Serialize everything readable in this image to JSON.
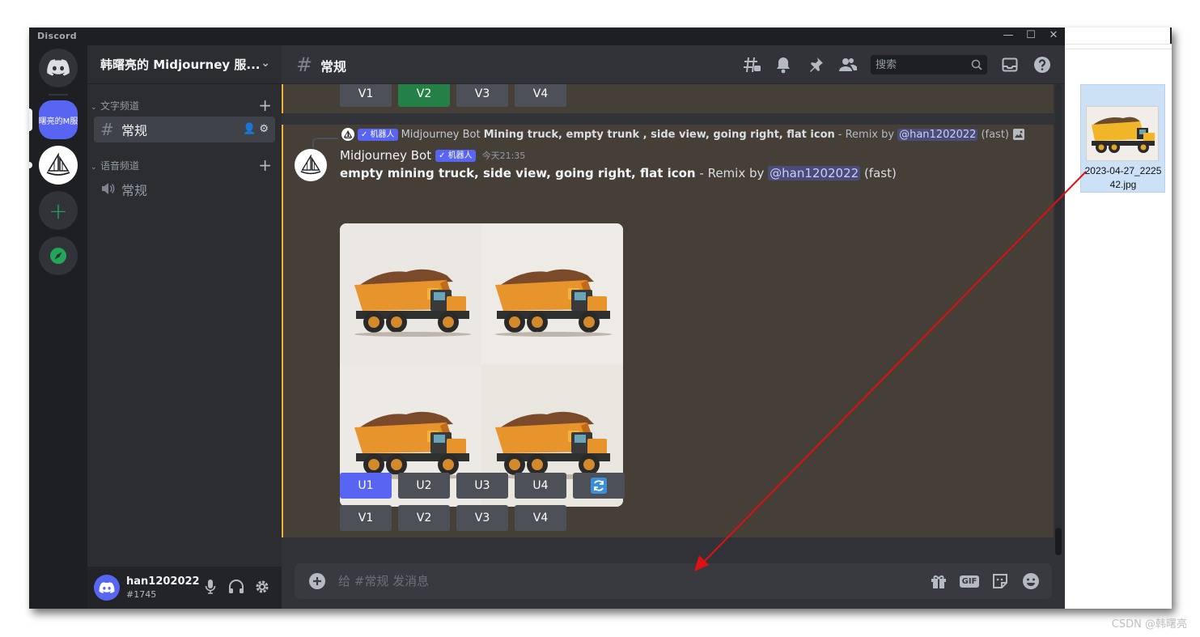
{
  "window": {
    "app_title": "Discord",
    "minimize": "—",
    "maximize": "☐",
    "close": "✕"
  },
  "server_rail": {
    "server1_label": "韩曙亮的M服务"
  },
  "sidebar": {
    "guild_name": "韩曙亮的 Midjourney 服...",
    "text_category": "文字频道",
    "voice_category": "语音频道",
    "text_channel": "常规",
    "voice_channel": "常规"
  },
  "user": {
    "name": "han1202022",
    "tag": "#1745"
  },
  "header": {
    "channel_title": "常规",
    "search_placeholder": "搜索"
  },
  "top_buttons": [
    "V1",
    "V2",
    "V3",
    "V4"
  ],
  "message": {
    "reply_badge": "✓ 机器人",
    "reply_author": "Midjourney Bot",
    "reply_prompt": "Mining truck, empty trunk , side view, going right, flat icon",
    "reply_suffix": "- Remix by",
    "reply_mention": "@han1202022",
    "reply_mode": "(fast)",
    "author": "Midjourney Bot",
    "badge": "✓ 机器人",
    "time": "今天21:35",
    "prompt": "empty mining truck, side view, going right, flat icon",
    "suffix": "- Remix by",
    "mention": "@han1202022",
    "mode": "(fast)",
    "u_buttons": [
      "U1",
      "U2",
      "U3",
      "U4"
    ],
    "v_buttons": [
      "V1",
      "V2",
      "V3",
      "V4"
    ]
  },
  "composer": {
    "placeholder": "给 #常规 发消息",
    "gif_label": "GIF"
  },
  "explorer": {
    "file_name": "2023-04-27_222542.jpg"
  },
  "watermark": "CSDN @韩曙亮",
  "colors": {
    "blurple": "#5865f2",
    "green": "#248046",
    "highlight_bar": "#f0b232",
    "annotation_arrow": "#e01010"
  }
}
